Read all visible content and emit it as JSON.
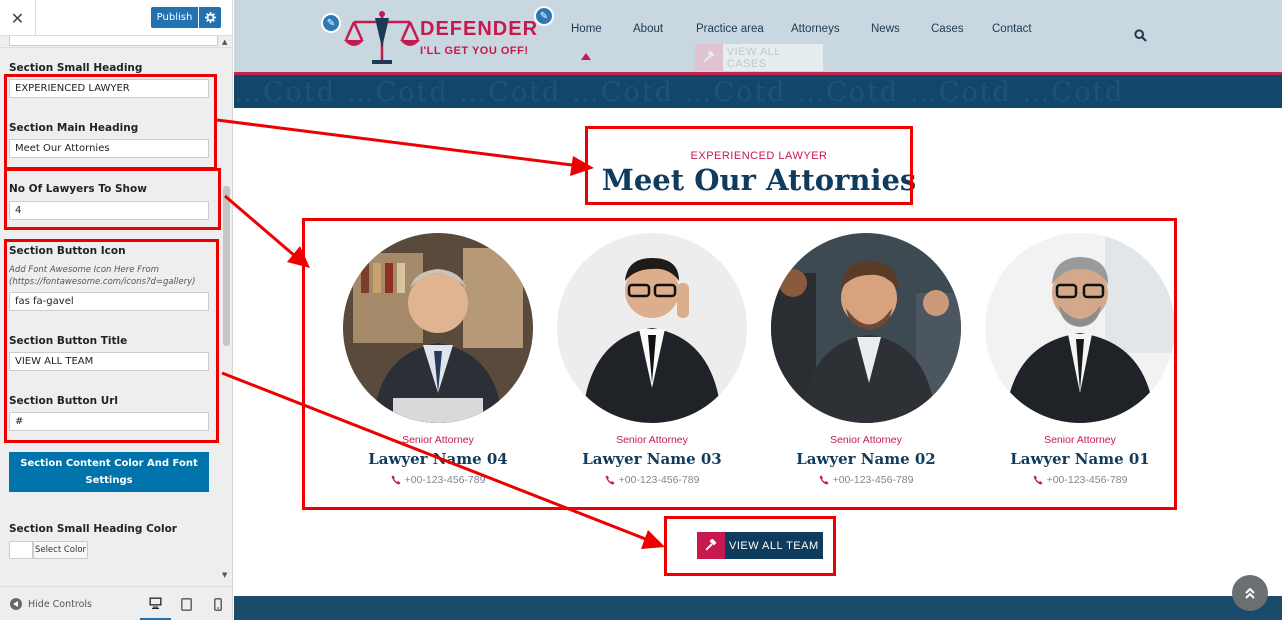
{
  "customizer": {
    "close_label": "✕",
    "publish_label": "Publish",
    "fields": {
      "small_heading": {
        "label": "Section Small Heading",
        "value": "EXPERIENCED LAWYER"
      },
      "main_heading": {
        "label": "Section Main Heading",
        "value": "Meet Our Attornies"
      },
      "lawyers_count": {
        "label": "No Of Lawyers To Show",
        "value": "4"
      },
      "button_icon": {
        "label": "Section Button Icon",
        "description": "Add Font Awesome Icon Here From (https://fontawesome.com/icons?d=gallery)",
        "value": "fas fa-gavel"
      },
      "button_title": {
        "label": "Section Button Title",
        "value": "VIEW ALL TEAM"
      },
      "button_url": {
        "label": "Section Button Url",
        "value": "#"
      }
    },
    "content_settings_button": "Section Content Color And Font Settings",
    "small_heading_color": {
      "label": "Section Small Heading Color",
      "select_label": "Select Color"
    },
    "footer": {
      "hide_controls": "Hide Controls"
    }
  },
  "site": {
    "logo": {
      "title": "DEFENDER",
      "tagline": "I'LL GET YOU OFF!"
    },
    "nav": [
      "Home",
      "About",
      "Practice area",
      "Attorneys",
      "News",
      "Cases",
      "Contact"
    ],
    "active_nav": "Home",
    "header_button": "VIEW ALL CASES",
    "banner_text": "…Cotd …Cotd …Cotd …Cotd …Cotd …Cotd …Cotd …Cotd",
    "section": {
      "small_heading": "EXPERIENCED LAWYER",
      "main_heading": "Meet Our Attornies",
      "button_label": "VIEW ALL TEAM"
    },
    "lawyers": [
      {
        "role": "Senior Attorney",
        "name": "Lawyer Name 04",
        "phone": "+00-123-456-789"
      },
      {
        "role": "Senior Attorney",
        "name": "Lawyer Name 03",
        "phone": "+00-123-456-789"
      },
      {
        "role": "Senior Attorney",
        "name": "Lawyer Name 02",
        "phone": "+00-123-456-789"
      },
      {
        "role": "Senior Attorney",
        "name": "Lawyer Name 01",
        "phone": "+00-123-456-789"
      }
    ]
  },
  "colors": {
    "accent": "#c8194e",
    "navy": "#0f3b5c",
    "wp_blue": "#2271b1",
    "annotation_red": "#ee0000"
  }
}
